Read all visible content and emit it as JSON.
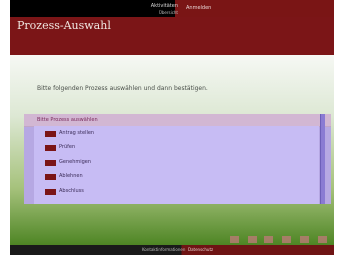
{
  "top_bar": {
    "left_text": "Aktivitäten",
    "left_subtext": "Übersicht",
    "right_text": "Anmelden"
  },
  "header": {
    "title": "Prozess-Auswahl"
  },
  "content": {
    "intro": "Bitte folgenden Prozess auswählen und dann bestätigen."
  },
  "panel": {
    "header_text": "Bitte Prozess auswählen",
    "items": [
      {
        "label": "Antrag stellen"
      },
      {
        "label": "Prüfen"
      },
      {
        "label": "Genehmigen"
      },
      {
        "label": "Ablehnen"
      },
      {
        "label": "Abschluss"
      }
    ]
  },
  "footer": {
    "left_text": "Kontaktinformationen",
    "right_text": "Datenschutz"
  },
  "colors": {
    "brand_red": "#7b1517",
    "panel_purple": "#b6a8e3",
    "list_purple": "#c7bcf4"
  }
}
